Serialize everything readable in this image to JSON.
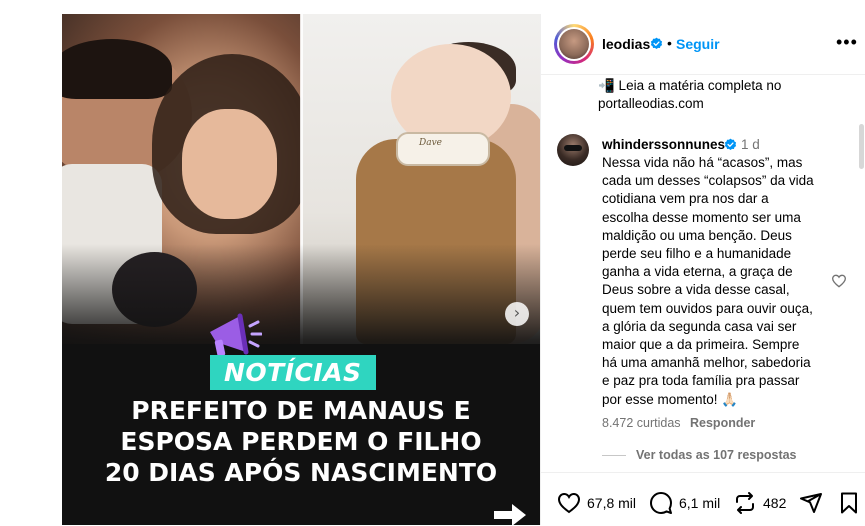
{
  "post": {
    "tag": "NOTÍCIAS",
    "headline": [
      "PREFEITO DE MANAUS E",
      "ESPOSA PERDEM O FILHO",
      "20 DIAS APÓS NASCIMENTO"
    ],
    "baby_collar_text": "Dave"
  },
  "header": {
    "username": "leodias",
    "separator": "•",
    "follow_label": "Seguir",
    "more_label": "•••"
  },
  "caption": {
    "lines": [
      "📲 Leia a matéria completa no",
      "portalleodias.com"
    ]
  },
  "comment": {
    "username": "whinderssonnunes",
    "time": "1 d",
    "lines": [
      "Nessa vida não há “acasos”, mas",
      "cada um desses “colapsos” da vida",
      "cotidiana vem pra nos dar a",
      "escolha desse momento ser uma",
      "maldição ou uma benção. Deus",
      "perde seu filho e a humanidade",
      "ganha a vida eterna, a graça de",
      "Deus sobre a vida desse casal,",
      "quem tem ouvidos para ouvir ouça,",
      "a glória da segunda casa vai ser",
      "maior que a da primeira. Sempre",
      "há uma amanhã melhor, sabedoria",
      "e paz pra toda família pra passar",
      "por esse momento! 🙏🏻"
    ],
    "likes": "8.472 curtidas",
    "reply_label": "Responder",
    "view_replies": "Ver todas as 107 respostas"
  },
  "actions": {
    "likes": "67,8 mil",
    "comments": "6,1 mil",
    "reposts": "482"
  },
  "colors": {
    "accent": "#0095f6",
    "tag_bg": "#2fd5c0",
    "muted": "#737373"
  },
  "icons": [
    "verified-icon",
    "more-icon",
    "heart-icon",
    "comment-icon",
    "repost-icon",
    "share-icon",
    "save-icon",
    "next-arrow-icon",
    "megaphone-icon"
  ]
}
